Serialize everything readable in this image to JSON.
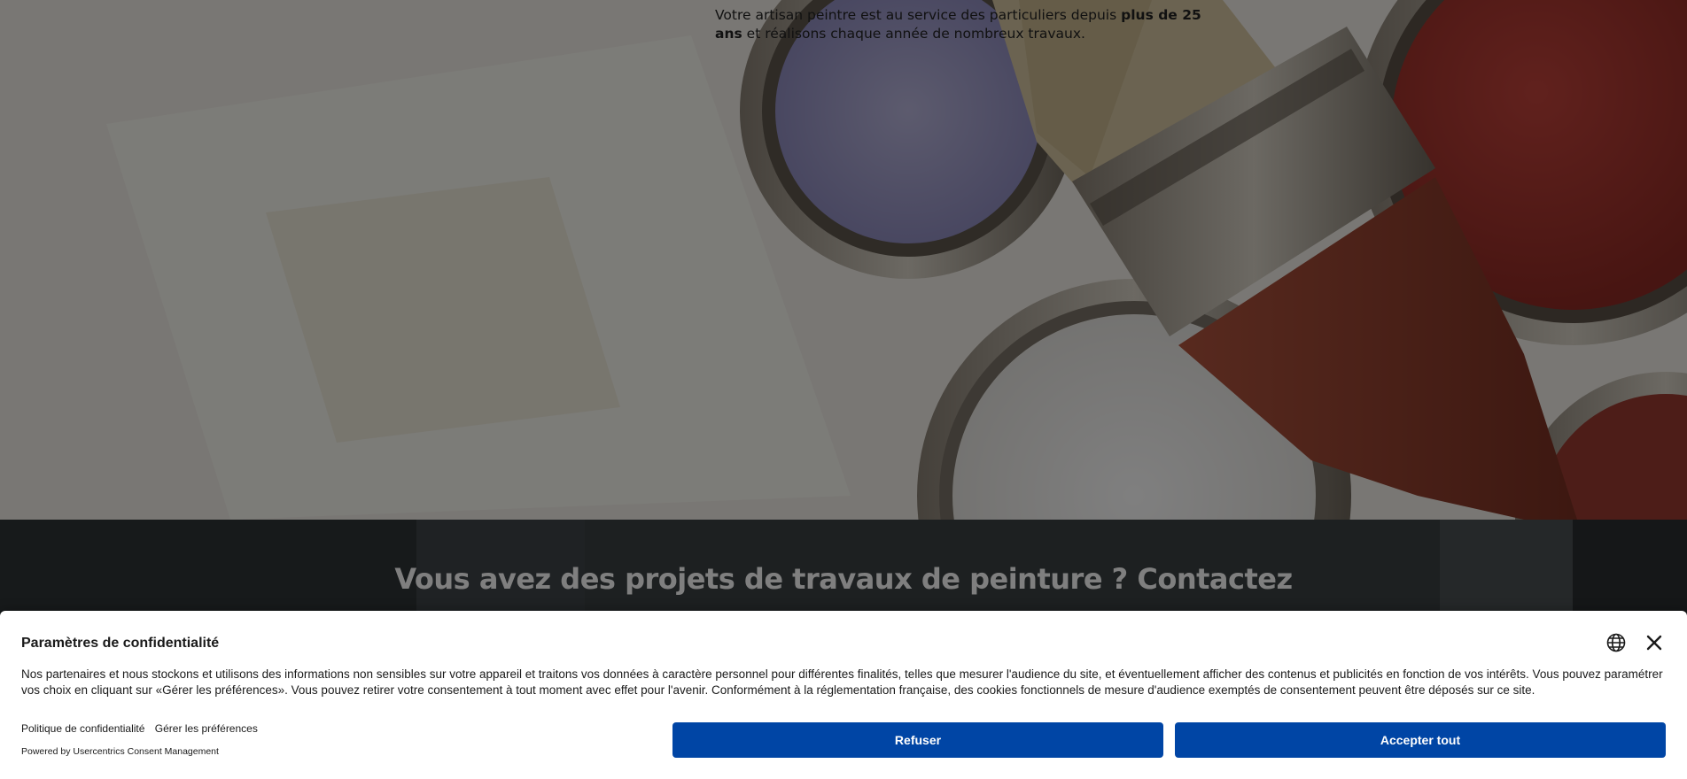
{
  "hero": {
    "intro_prefix": "Votre artisan peintre est au service des particuliers depuis ",
    "intro_bold": "plus de 25 ans",
    "intro_suffix": " et réalisons chaque année de nombreux travaux."
  },
  "cta": {
    "title": "Vous avez des projets de travaux de peinture ? Contactez"
  },
  "consent": {
    "title": "Paramètres de confidentialité",
    "body": "Nos partenaires et nous stockons et utilisons des informations non sensibles sur votre appareil et traitons vos données à caractère personnel pour différentes finalités, telles que mesurer l'audience du site, et éventuellement afficher des contenus et publicités en fonction de vos intérêts. Vous pouvez paramétrer vos choix en cliquant sur «Gérer les préférences». Vous pouvez retirer votre consentement à tout moment avec effet pour l'avenir. Conformément à la réglementation française, des cookies fonctionnels de mesure d'audience exemptés de consentement peuvent être déposés sur ce site.",
    "privacy_link": "Politique de confidentialité",
    "prefs_link": "Gérer les préférences",
    "powered_by": "Powered by Usercentrics Consent Management",
    "refuse_label": "Refuser",
    "accept_label": "Accepter tout",
    "language_icon": "globe-icon",
    "close_icon": "close-icon",
    "button_color": "#0045a5"
  }
}
